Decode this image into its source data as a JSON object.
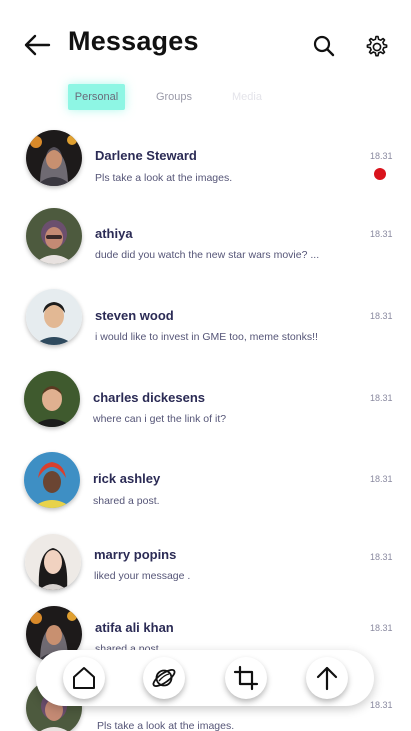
{
  "header": {
    "title": "Messages",
    "back_icon": "arrow-left-icon",
    "search_icon": "search-icon",
    "settings_icon": "gear-icon"
  },
  "tabs": [
    {
      "label": "Personal",
      "active": true
    },
    {
      "label": "Groups",
      "active": false
    },
    {
      "label": "Media",
      "active": false
    }
  ],
  "conversations": [
    {
      "name": "Darlene Steward",
      "preview": "Pls take a look at the images.",
      "time": "18.31",
      "unread": true
    },
    {
      "name": "athiya",
      "preview": "dude  did you watch the new star wars movie? ...",
      "time": "18.31",
      "unread": false
    },
    {
      "name": "steven  wood",
      "preview": "i would like to invest in GME too, meme stonks!!",
      "time": "18.31",
      "unread": false
    },
    {
      "name": "charles dickesens",
      "preview": "where can i get the link of it?",
      "time": "18.31",
      "unread": false
    },
    {
      "name": "rick ashley",
      "preview": "shared a post.",
      "time": "18.31",
      "unread": false
    },
    {
      "name": "marry popins",
      "preview": "liked your message .",
      "time": "18.31",
      "unread": false
    },
    {
      "name": "atifa ali khan",
      "preview": "shared a post.",
      "time": "18.31",
      "unread": false
    },
    {
      "name": "",
      "preview": "Pls take a look at the images.",
      "time": "18.31",
      "unread": false
    }
  ],
  "bottom_nav": [
    {
      "icon": "home-icon"
    },
    {
      "icon": "planet-icon"
    },
    {
      "icon": "crop-icon"
    },
    {
      "icon": "arrow-up-icon"
    }
  ],
  "colors": {
    "active_tab": "#8ef6e4",
    "unread_dot": "#d9131c",
    "name_text": "#2b2b55"
  }
}
